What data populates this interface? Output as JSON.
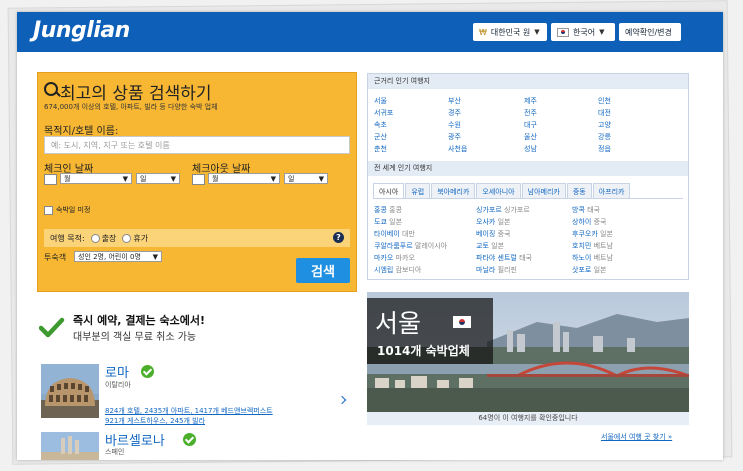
{
  "header": {
    "logo": "Junglian",
    "currency": "대한민국 원",
    "language": "한국어",
    "booking": "예약확인/변경"
  },
  "search": {
    "title": "최고의 상품 검색하기",
    "subtitle": "674,000개 이상의 호텔, 아파트, 빌라 등 다양한 숙박 업체",
    "dest_label": "목적지/호텔 이름:",
    "dest_placeholder": "예: 도시, 지역, 지구 또는 호텔 이름",
    "checkin_label": "체크인 날짜",
    "checkout_label": "체크아웃 날짜",
    "month": "월",
    "day": "일",
    "no_dates": "숙박일 미정",
    "purpose_label": "여행 목적:",
    "purpose_business": "출장",
    "purpose_leisure": "휴가",
    "guests_label": "투숙객",
    "guests_value": "성인 2명, 어린이 0명",
    "button": "검색"
  },
  "promo": {
    "line1": "즉시 예약, 결제는 숙소에서!",
    "line2": "대부분의 객실 무료 취소 가능"
  },
  "cities": [
    {
      "name": "로마",
      "country": "이탈리아",
      "links": [
        "824개 호텔",
        "2435개 아파트",
        "1417개 베드앤브렉퍼스트",
        "921개 게스트하우스",
        "245개 빌라"
      ]
    },
    {
      "name": "바르셀로나",
      "country": "스페인"
    }
  ],
  "nearby": {
    "heading": "근거리 인기 여행지",
    "columns": [
      [
        "서울",
        "서귀포",
        "속초",
        "군산",
        "춘천"
      ],
      [
        "부산",
        "경주",
        "수원",
        "광주",
        "사천읍"
      ],
      [
        "제주",
        "전주",
        "대구",
        "울산",
        "성남"
      ],
      [
        "인천",
        "대전",
        "고양",
        "강릉",
        "정읍"
      ]
    ]
  },
  "world": {
    "heading": "전 세계 인기 여행지",
    "tabs": [
      "아시아",
      "유럽",
      "북아메리카",
      "오세아니아",
      "남아메리카",
      "중동",
      "아프리카"
    ],
    "columns": [
      [
        [
          "홍콩",
          "홍콩"
        ],
        [
          "도쿄",
          "일본"
        ],
        [
          "타이베이",
          "대만"
        ],
        [
          "쿠알라룸푸르",
          "말레이시아"
        ],
        [
          "마카오",
          "마카오"
        ],
        [
          "시엠립",
          "캄보디아"
        ]
      ],
      [
        [
          "싱가포르",
          "싱가포르"
        ],
        [
          "오사카",
          "일본"
        ],
        [
          "베이징",
          "중국"
        ],
        [
          "교토",
          "일본"
        ],
        [
          "파타야 센트럴",
          "태국"
        ],
        [
          "마닐라",
          "필리핀"
        ]
      ],
      [
        [
          "방콕",
          "태국"
        ],
        [
          "상하이",
          "중국"
        ],
        [
          "후쿠오카",
          "일본"
        ],
        [
          "호치민",
          "베트남"
        ],
        [
          "하노이",
          "베트남"
        ],
        [
          "삿포로",
          "일본"
        ]
      ]
    ]
  },
  "featured": {
    "city": "서울",
    "count": "1014개 숙박업체",
    "caption": "64명이 이 여행지를 확인중입니다",
    "more": "서울에서 여행 곳 찾기 »"
  }
}
